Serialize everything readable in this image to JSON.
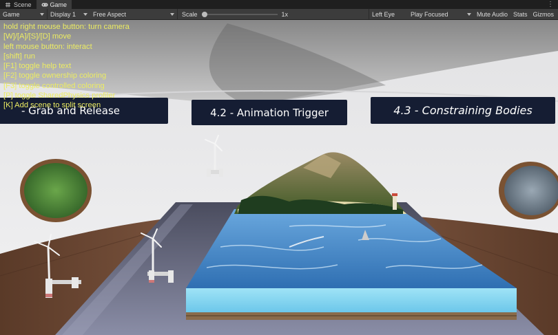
{
  "tabs": [
    {
      "label": "Scene",
      "icon": "scene-hash-icon",
      "active": false
    },
    {
      "label": "Game",
      "icon": "game-controller-icon",
      "active": true
    }
  ],
  "toolbar": {
    "display_mode": "Game",
    "display": "Display 1",
    "aspect": "Free Aspect",
    "scale_label": "Scale",
    "scale_value": "1x",
    "eye": "Left Eye",
    "play_mode": "Play Focused",
    "mute_audio": "Mute Audio",
    "stats": "Stats",
    "gizmos": "Gizmos"
  },
  "help_lines": [
    "hold right mouse button: turn camera",
    "[W]/[A]/[S]/[D] move",
    "left mouse button: interact",
    "[shift] run",
    "[F1] toggle help text",
    "[F2] toggle ownership coloring",
    "[F3] toggle controlled coloring",
    "[P] toggle SharedPhysics profiler",
    "[K] Add scene to split screen"
  ],
  "signs": {
    "left": "- Grab and Release",
    "center": "4.2 - Animation Trigger",
    "right": "4.3 - Constraining Bodies"
  },
  "colors": {
    "help_text": "#ecec62",
    "sign_bg": "#151d33",
    "water": "#3f86c9",
    "floor_wood": "#6b4631"
  }
}
